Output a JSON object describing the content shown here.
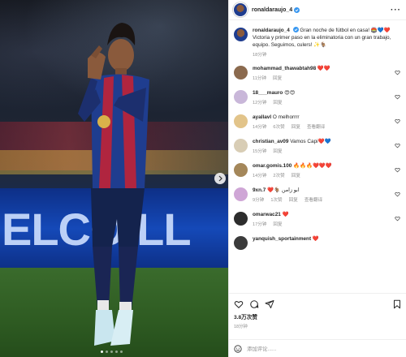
{
  "post": {
    "author": "ronaldaraujo_4",
    "caption_line1": "Gran noche de fútbol en casa! ",
    "caption_emojis1": "🏟️💙❤️",
    "caption_line2": "Victoria y primer paso en la eliminatoria con un gran trabajo, equipo. Seguimos, culers! ",
    "caption_emojis2": "✨🐐",
    "caption_time": "18分钟",
    "likes": "3.8万次赞",
    "time": "18分钟",
    "add_comment_placeholder": "添加评论......",
    "photo_adboard_text": "ELCO  LL"
  },
  "comments": [
    {
      "user": "mohammad_thawabtah98",
      "text": "❤️❤️",
      "time": "11分钟",
      "likes": "",
      "reply": "回复",
      "avatar_color": "#8b6a4e"
    },
    {
      "user": "18___mauro",
      "text": "😍😍",
      "time": "12分钟",
      "likes": "",
      "reply": "回复",
      "avatar_color": "#c9b7d9"
    },
    {
      "user": "ayallavl",
      "text": "O melhorrrr",
      "time": "14分钟",
      "likes": "6次赞",
      "reply": "回复",
      "translate": "查看翻译",
      "avatar_color": "#e2c48a"
    },
    {
      "user": "christian_av09",
      "text": "Vamos Capi❤️💙",
      "time": "15分钟",
      "likes": "",
      "reply": "回复",
      "avatar_color": "#d8cdb5"
    },
    {
      "user": "omar.gomis.100",
      "text": "🔥🔥🔥❤️❤️❤️",
      "time": "14分钟",
      "likes": "2次赞",
      "reply": "回复",
      "avatar_color": "#a4875a"
    },
    {
      "user": "9xn.7",
      "text": "❤️🐐 ابو زامن",
      "time": "9分钟",
      "likes": "1次赞",
      "reply": "回复",
      "translate": "查看翻译",
      "avatar_color": "#cfa6d6"
    },
    {
      "user": "omarwac21",
      "text": "❤️",
      "time": "17分钟",
      "likes": "",
      "reply": "回复",
      "avatar_color": "#2d2d2d"
    },
    {
      "user": "yanquish_sportainment",
      "text": "❤️",
      "time": "",
      "likes": "",
      "reply": "",
      "avatar_color": "#3b3b3b"
    }
  ],
  "colors": {
    "verified": "#3897f0",
    "like_red": "#ed4956"
  }
}
